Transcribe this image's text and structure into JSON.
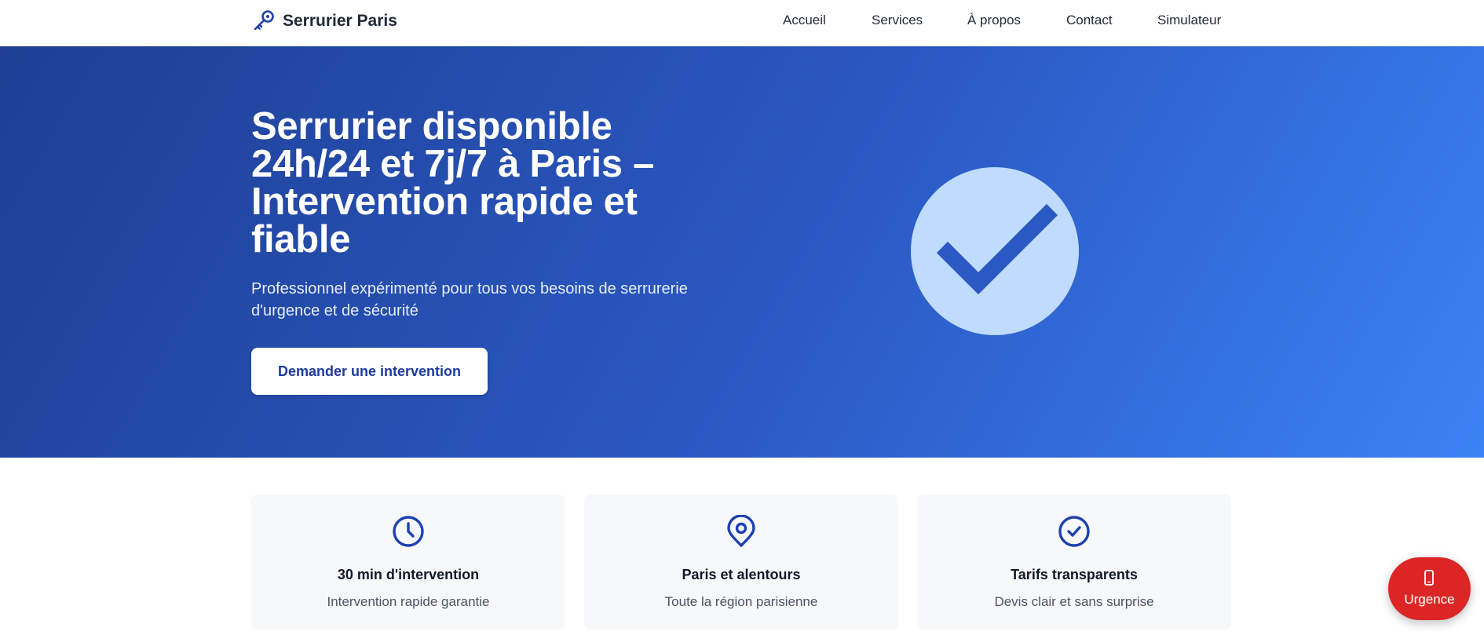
{
  "header": {
    "brand_name": "Serrurier Paris",
    "nav": [
      {
        "label": "Accueil"
      },
      {
        "label": "Services"
      },
      {
        "label": "À propos"
      },
      {
        "label": "Contact"
      },
      {
        "label": "Simulateur"
      }
    ]
  },
  "hero": {
    "title": "Serrurier disponible 24h/24 et 7j/7 à Paris – Intervention rapide et fiable",
    "subtitle": "Professionnel expérimenté pour tous vos besoins de serrurerie d'urgence et de sécurité",
    "cta_label": "Demander une intervention",
    "illustration_icon": "check-circle-icon"
  },
  "features": [
    {
      "icon": "clock-icon",
      "title": "30 min d'intervention",
      "description": "Intervention rapide garantie"
    },
    {
      "icon": "map-pin-icon",
      "title": "Paris et alentours",
      "description": "Toute la région parisienne"
    },
    {
      "icon": "check-circle-icon",
      "title": "Tarifs transparents",
      "description": "Devis clair et sans surprise"
    }
  ],
  "urgent": {
    "label": "Urgence",
    "icon": "phone-icon"
  },
  "colors": {
    "primary": "#1e40af",
    "hero_gradient_start": "#1e3f94",
    "hero_gradient_end": "#3b82f6",
    "check_circle": "#bfdbfe",
    "urgent": "#dc2626",
    "card_bg": "#f7f8fa"
  }
}
